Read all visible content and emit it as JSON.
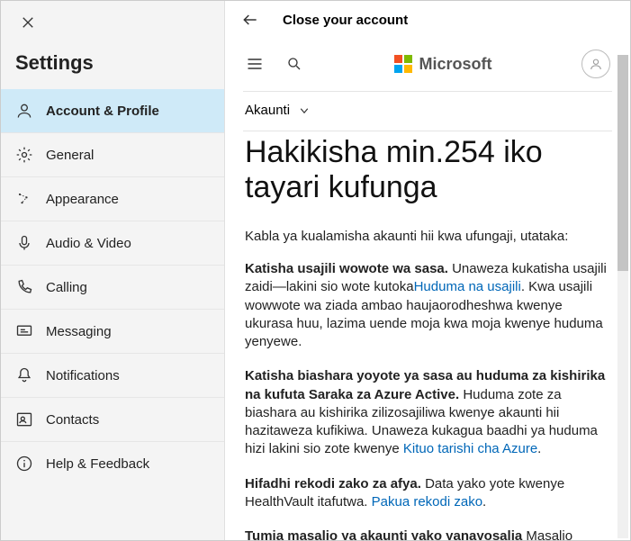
{
  "sidebar": {
    "title": "Settings",
    "items": [
      {
        "label": "Account & Profile"
      },
      {
        "label": "General"
      },
      {
        "label": "Appearance"
      },
      {
        "label": "Audio & Video"
      },
      {
        "label": "Calling"
      },
      {
        "label": "Messaging"
      },
      {
        "label": "Notifications"
      },
      {
        "label": "Contacts"
      },
      {
        "label": "Help & Feedback"
      }
    ]
  },
  "titlebar": {
    "title": "Close your account"
  },
  "header": {
    "brand": "Microsoft"
  },
  "breadcrumb": {
    "label": "Akaunti"
  },
  "article": {
    "heading": "Hakikisha min.254 iko tayari kufunga",
    "lead": "Kabla ya kualamisha akaunti hii kwa ufungaji, utataka:",
    "p1_bold": "Katisha usajili wowote wa sasa.",
    "p1_text_a": " Unaweza kukatisha usajili zaidi—lakini sio wote kutoka",
    "p1_link": "Huduma na usajili",
    "p1_text_b": ". Kwa usajili wowwote wa ziada ambao haujaorodheshwa kwenye ukurasa huu, lazima uende moja kwa moja kwenye huduma yenyewe.",
    "p2_bold": "Katisha biashara yoyote ya sasa au huduma za kishirika na kufuta Saraka za Azure Active.",
    "p2_text_a": " Huduma zote za biashara au kishirika zilizosajiliwa kwenye akaunti hii hazitaweza kufikiwa. Unaweza kukagua baadhi ya huduma hizi lakini sio zote kwenye ",
    "p2_link": "Kituo tarishi cha Azure",
    "p2_text_b": ".",
    "p3_bold": "Hifadhi rekodi zako za afya.",
    "p3_text_a": " Data yako yote kwenye HealthVault itafutwa. ",
    "p3_link": "Pakua rekodi zako",
    "p3_text_b": ".",
    "p4_bold": "Tumia masalio ya akaunti yako yanayosalia",
    "p4_text_a": " Masalio"
  }
}
